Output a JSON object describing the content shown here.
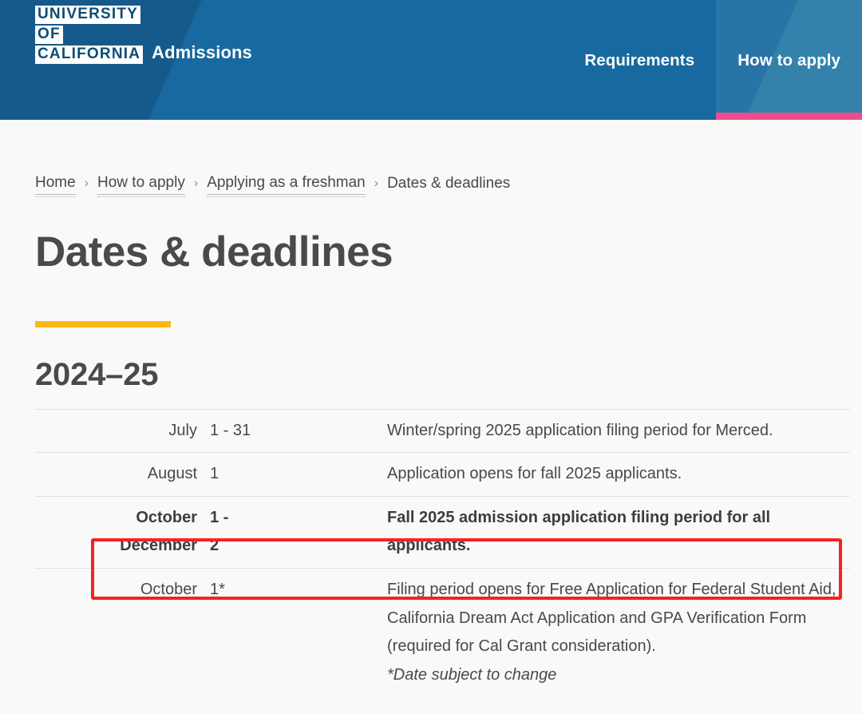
{
  "header": {
    "logo_lines": [
      "UNIVERSITY",
      "OF",
      "CALIFORNIA"
    ],
    "brand_subtitle": "Admissions",
    "nav": [
      {
        "label": "Requirements",
        "active": false
      },
      {
        "label": "How to apply",
        "active": true
      }
    ],
    "colors": {
      "header_blue": "#17699f",
      "header_blue_dark": "#155a8a",
      "header_blue_light": "#2478a6",
      "active_underline_pink": "#ec4d8e",
      "logo_text_blue": "#0e4c74"
    }
  },
  "breadcrumb": {
    "items": [
      {
        "label": "Home",
        "current": false
      },
      {
        "label": "How to apply",
        "current": false
      },
      {
        "label": "Applying as a freshman",
        "current": false
      },
      {
        "label": "Dates & deadlines",
        "current": true
      }
    ],
    "separator": "›"
  },
  "main": {
    "page_title": "Dates & deadlines",
    "gold_rule_color": "#fdb913",
    "year_heading": "2024–25",
    "table": {
      "rows": [
        {
          "month": "July",
          "day": "1 - 31",
          "description": "Winter/spring 2025 application filing period for Merced.",
          "note": "",
          "highlighted": false
        },
        {
          "month": "August",
          "day": "1",
          "description": "Application opens for fall 2025 applicants.",
          "note": "",
          "highlighted": false
        },
        {
          "month": "October -\nDecember",
          "month_line1": "October",
          "month_line2": "December",
          "day_line1": "1 -",
          "day_line2": "2",
          "day": "1 - 2",
          "description": "Fall 2025 admission application filing period for all applicants.",
          "note": "",
          "highlighted": true
        },
        {
          "month": "October",
          "day": "1*",
          "description": "Filing period opens for Free Application for Federal Student Aid, California Dream Act Application and GPA Verification Form (required for Cal Grant consideration).",
          "note": "*Date subject to change",
          "highlighted": false
        }
      ]
    }
  },
  "annotation": {
    "color": "#fa2020",
    "target_row_index": 2
  }
}
